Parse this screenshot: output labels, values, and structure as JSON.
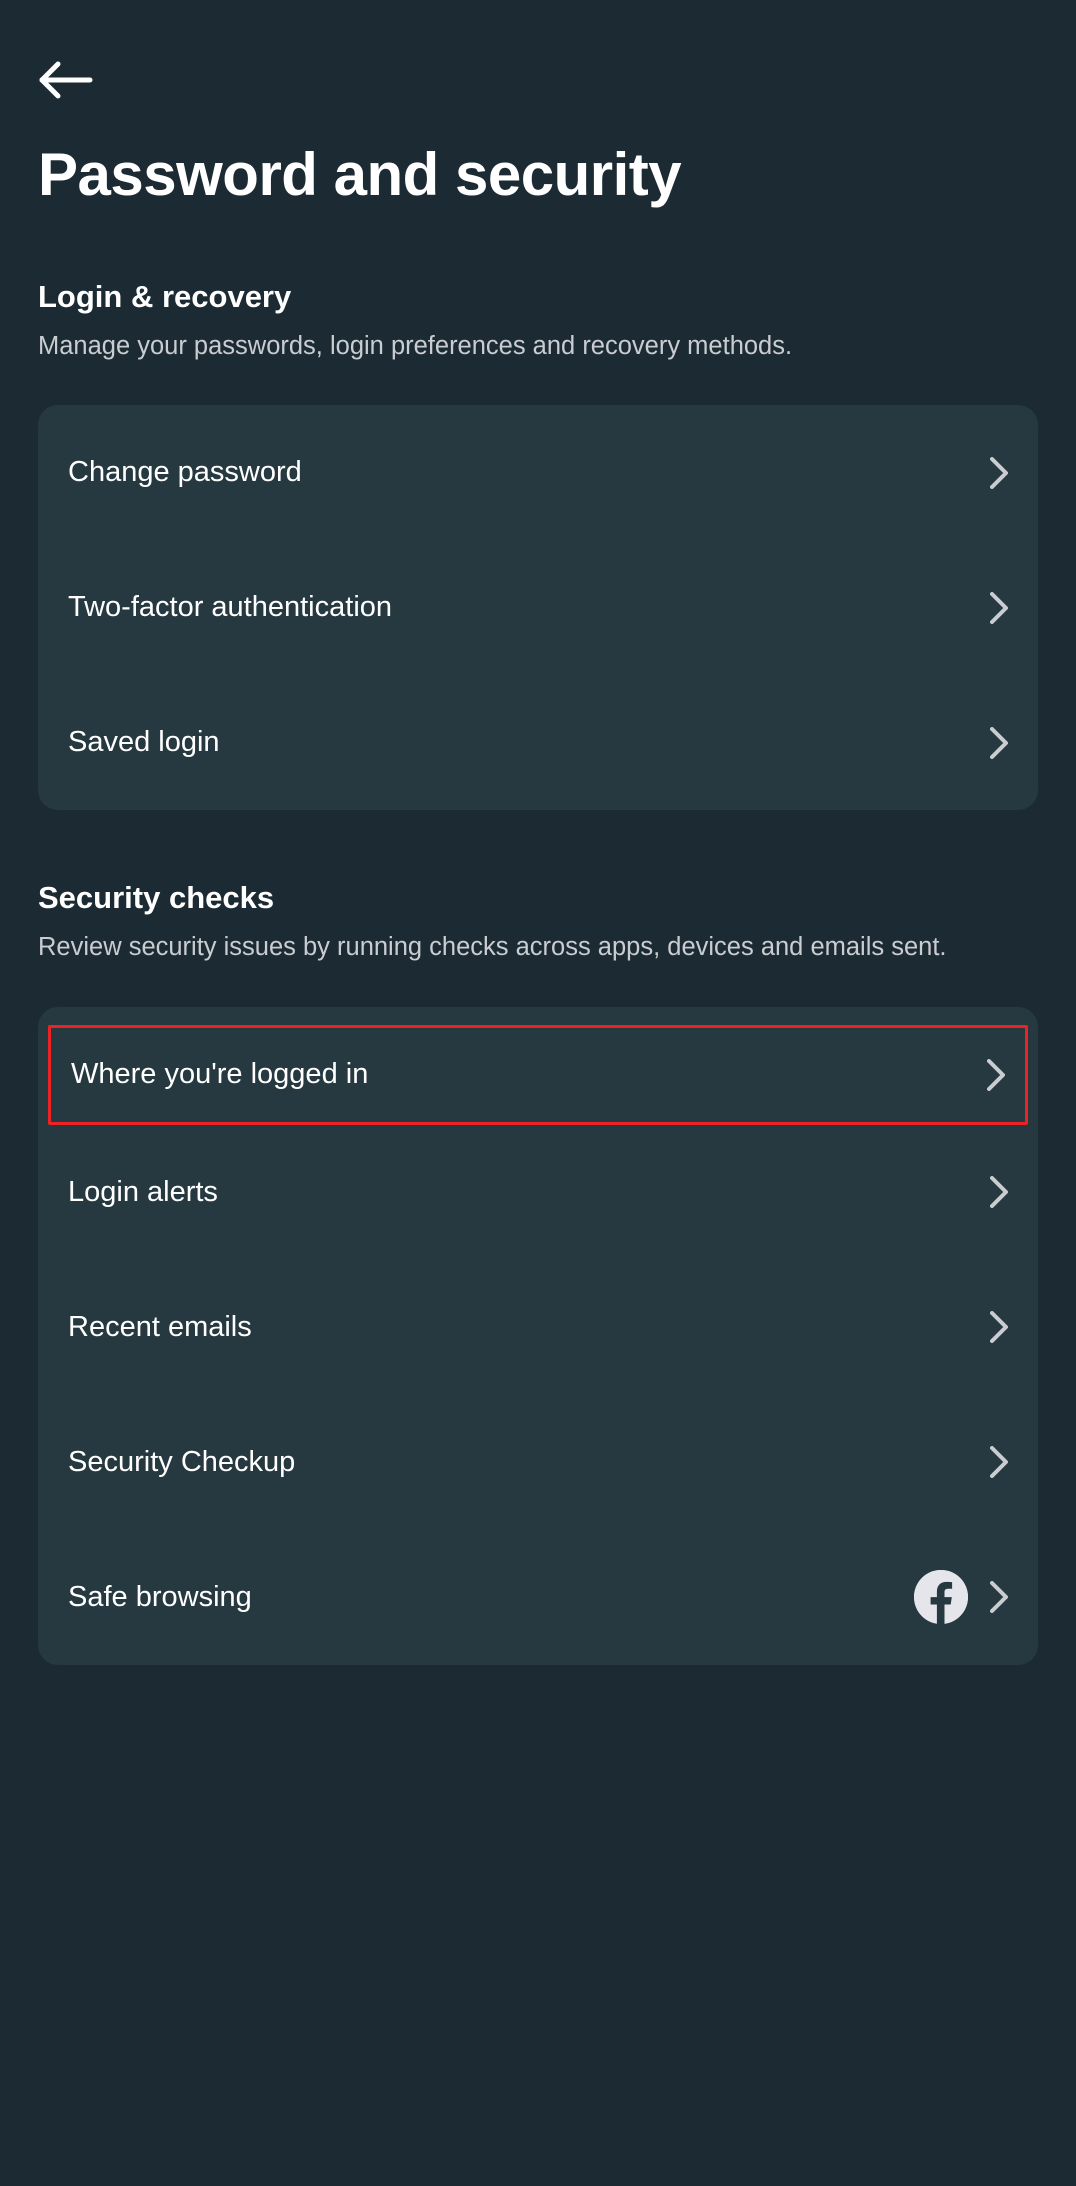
{
  "page_title": "Password and security",
  "sections": [
    {
      "title": "Login & recovery",
      "subtitle": "Manage your passwords, login preferences and recovery methods.",
      "items": [
        {
          "label": "Change password"
        },
        {
          "label": "Two-factor authentication"
        },
        {
          "label": "Saved login"
        }
      ]
    },
    {
      "title": "Security checks",
      "subtitle": "Review security issues by running checks across apps, devices and emails sent.",
      "items": [
        {
          "label": "Where you're logged in",
          "highlighted": true
        },
        {
          "label": "Login alerts"
        },
        {
          "label": "Recent emails"
        },
        {
          "label": "Security Checkup"
        },
        {
          "label": "Safe browsing",
          "badge": "facebook"
        }
      ]
    }
  ]
}
